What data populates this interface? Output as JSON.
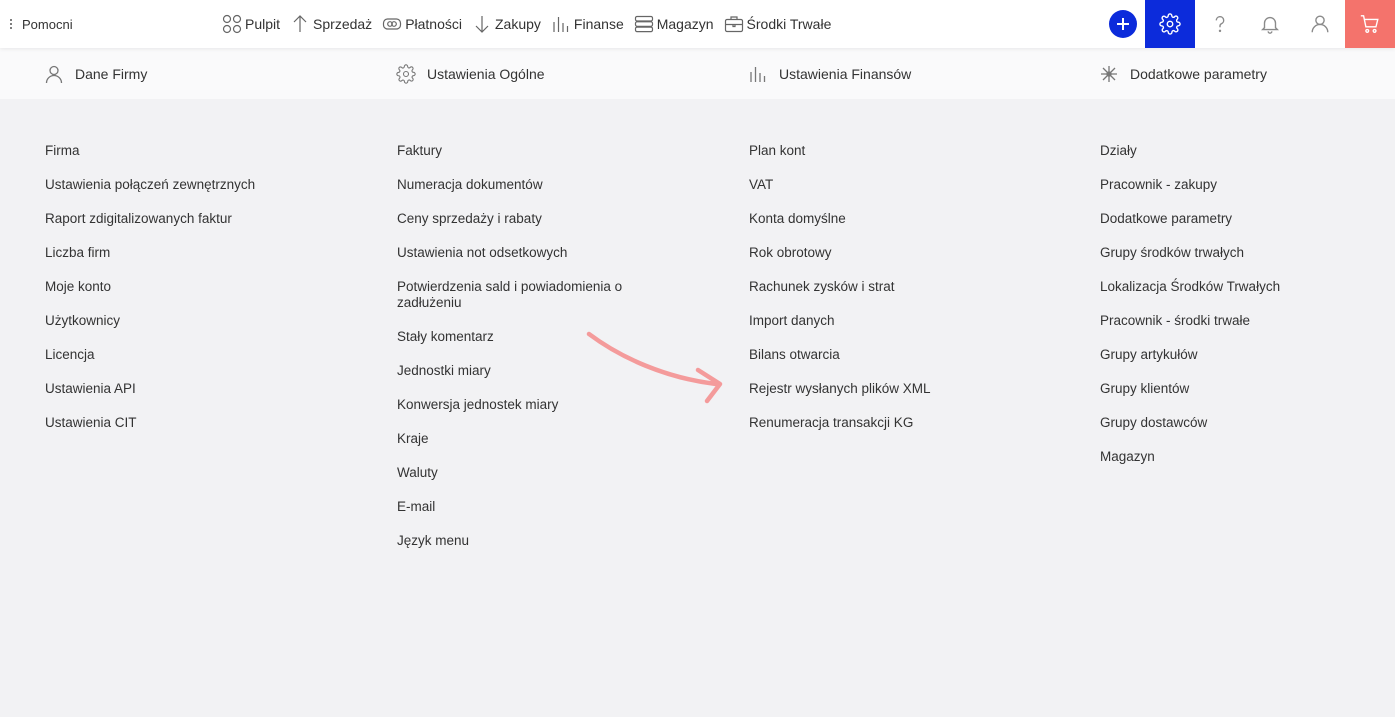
{
  "app": {
    "name": "Pomocni"
  },
  "nav": [
    {
      "label": "Pulpit",
      "icon": "dashboard-icon"
    },
    {
      "label": "Sprzedaż",
      "icon": "arrow-up-icon"
    },
    {
      "label": "Płatności",
      "icon": "payment-icon"
    },
    {
      "label": "Zakupy",
      "icon": "arrow-down-icon"
    },
    {
      "label": "Finanse",
      "icon": "bar-chart-icon"
    },
    {
      "label": "Magazyn",
      "icon": "warehouse-icon"
    },
    {
      "label": "Środki Trwałe",
      "icon": "briefcase-icon"
    }
  ],
  "toolbar_icons": [
    "plus-icon",
    "gear-icon",
    "help-icon",
    "bell-icon",
    "user-icon",
    "cart-icon"
  ],
  "colors": {
    "accent": "#0c2bdb",
    "cart": "#f4736c",
    "arrow": "#f49b9b",
    "background": "#f2f2f4"
  },
  "subnav": [
    {
      "label": "Dane Firmy",
      "icon": "user-icon"
    },
    {
      "label": "Ustawienia Ogólne",
      "icon": "gear-icon"
    },
    {
      "label": "Ustawienia Finansów",
      "icon": "bar-chart-icon"
    },
    {
      "label": "Dodatkowe parametry",
      "icon": "network-icon"
    }
  ],
  "columns": [
    {
      "links": [
        "Firma",
        "Ustawienia połączeń zewnętrznych",
        "Raport zdigitalizowanych faktur",
        "Liczba firm",
        "Moje konto",
        "Użytkownicy",
        "Licencja",
        "Ustawienia API",
        "Ustawienia CIT"
      ]
    },
    {
      "links": [
        "Faktury",
        "Numeracja dokumentów",
        "Ceny sprzedaży i rabaty",
        "Ustawienia not odsetkowych",
        "Potwierdzenia sald i powiadomienia o zadłużeniu",
        "Stały komentarz",
        "Jednostki miary",
        "Konwersja jednostek miary",
        "Kraje",
        "Waluty",
        "E-mail",
        "Język menu"
      ]
    },
    {
      "links": [
        "Plan kont",
        "VAT",
        "Konta domyślne",
        "Rok obrotowy",
        "Rachunek zysków i strat",
        "Import danych",
        "Bilans otwarcia",
        "Rejestr wysłanych plików XML",
        "Renumeracja transakcji KG"
      ]
    },
    {
      "links": [
        "Działy",
        "Pracownik - zakupy",
        "Dodatkowe parametry",
        "Grupy środków trwałych",
        "Lokalizacja Środków Trwałych",
        "Pracownik - środki trwałe",
        "Grupy artykułów",
        "Grupy klientów",
        "Grupy dostawców",
        "Magazyn"
      ]
    }
  ]
}
